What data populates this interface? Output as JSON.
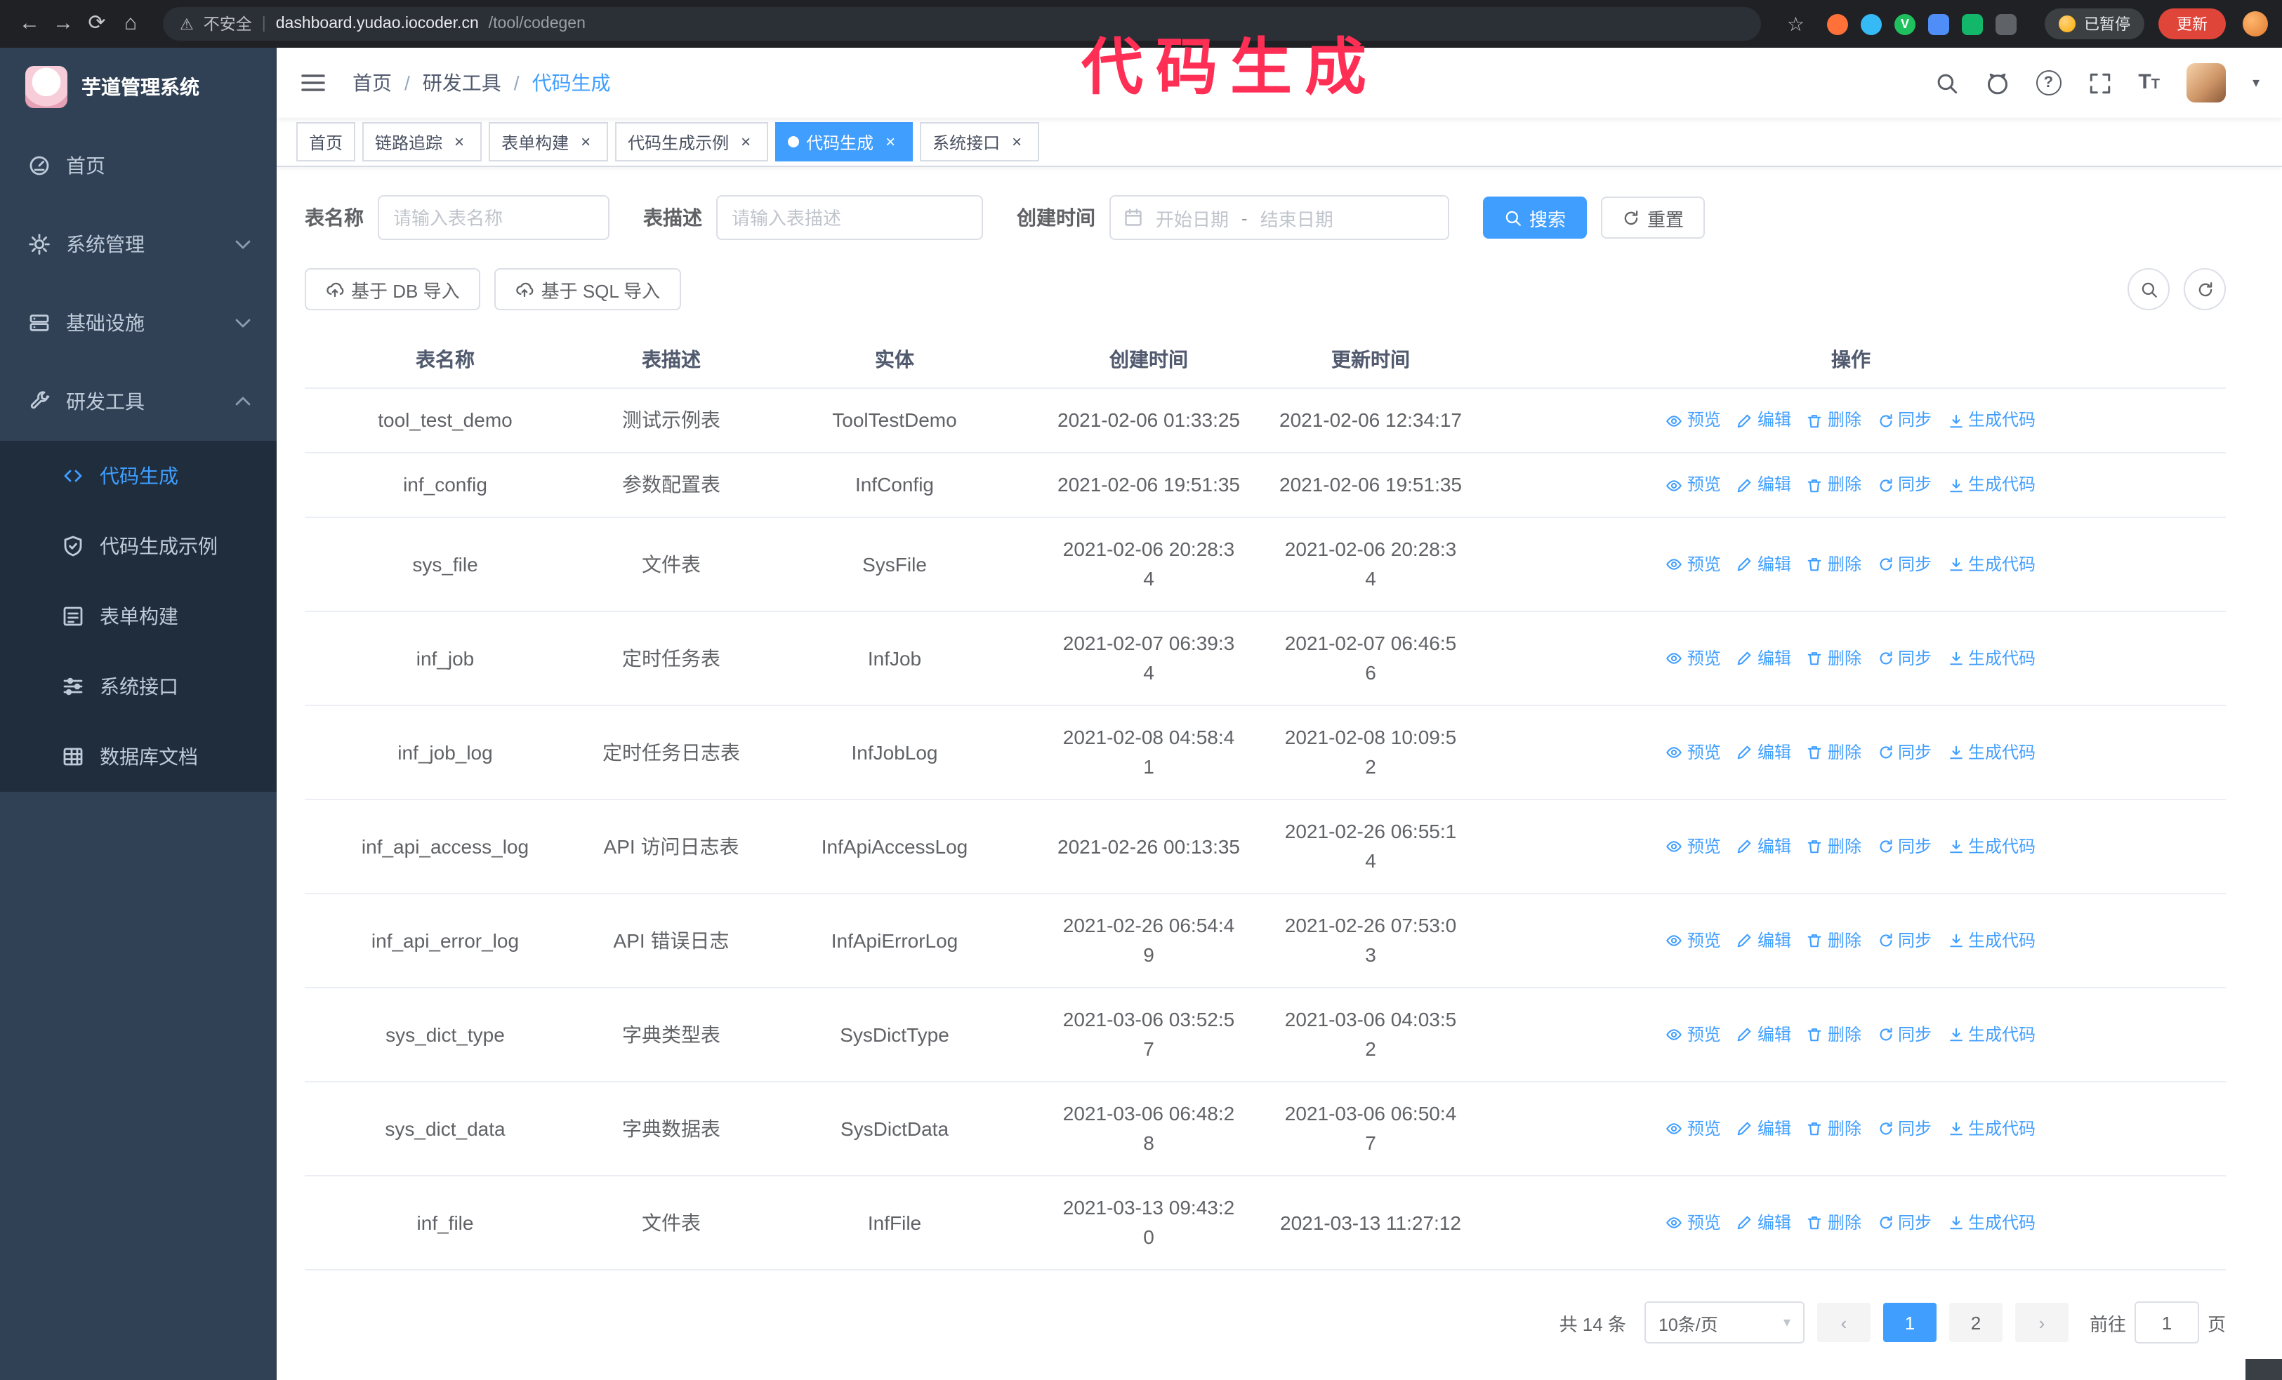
{
  "theme": {
    "accent": "#409eff",
    "sidebar_bg": "#304156",
    "submenu_bg": "#1f2d3d",
    "sidebar_text": "#bfcbd9",
    "chrome_bg": "#202124",
    "danger": "#e0453a",
    "annotation_color": "#ff2e55"
  },
  "annotation": {
    "text": "代码生成"
  },
  "glyphs": {
    "back": "←",
    "forward": "→",
    "reload": "⟳",
    "home": "⌂",
    "warning": "⚠",
    "star": "☆",
    "pipe": "|",
    "slash": "/",
    "close": "×",
    "caret_down": "▾",
    "prev": "‹",
    "next": "›",
    "letter_T": "T",
    "question": "?",
    "ext_v": "V"
  },
  "browser": {
    "security_label": "不安全",
    "url_host": "dashboard.yudao.iocoder.cn",
    "url_path": "/tool/codegen",
    "paused_badge": "已暂停",
    "update_button": "更新"
  },
  "sidebar": {
    "logo_title": "芋道管理系统",
    "items": [
      {
        "label": "首页",
        "icon": "dashboard-icon"
      },
      {
        "label": "系统管理",
        "icon": "gear-icon"
      },
      {
        "label": "基础设施",
        "icon": "server-icon"
      },
      {
        "label": "研发工具",
        "icon": "tools-icon"
      }
    ],
    "submenu": [
      {
        "label": "代码生成",
        "icon": "code-icon",
        "active": true
      },
      {
        "label": "代码生成示例",
        "icon": "shield-check-icon"
      },
      {
        "label": "表单构建",
        "icon": "form-icon"
      },
      {
        "label": "系统接口",
        "icon": "sliders-icon"
      },
      {
        "label": "数据库文档",
        "icon": "grid-icon"
      }
    ]
  },
  "navbar": {
    "breadcrumb": [
      "首页",
      "研发工具",
      "代码生成"
    ]
  },
  "tabs": [
    {
      "label": "首页",
      "closable": false,
      "active": false
    },
    {
      "label": "链路追踪",
      "closable": true,
      "active": false
    },
    {
      "label": "表单构建",
      "closable": true,
      "active": false
    },
    {
      "label": "代码生成示例",
      "closable": true,
      "active": false
    },
    {
      "label": "代码生成",
      "closable": true,
      "active": true
    },
    {
      "label": "系统接口",
      "closable": true,
      "active": false
    }
  ],
  "filters": {
    "table_name_label": "表名称",
    "table_name_placeholder": "请输入表名称",
    "table_desc_label": "表描述",
    "table_desc_placeholder": "请输入表描述",
    "create_time_label": "创建时间",
    "date_start_placeholder": "开始日期",
    "date_separator": "-",
    "date_end_placeholder": "结束日期",
    "search_button": "搜索",
    "reset_button": "重置"
  },
  "toolbar": {
    "import_db": "基于 DB 导入",
    "import_sql": "基于 SQL 导入"
  },
  "table": {
    "columns": [
      "表名称",
      "表描述",
      "实体",
      "创建时间",
      "更新时间",
      "操作"
    ],
    "actions": [
      "预览",
      "编辑",
      "删除",
      "同步",
      "生成代码"
    ],
    "rows": [
      {
        "name": "tool_test_demo",
        "desc": "测试示例表",
        "entity": "ToolTestDemo",
        "created": "2021-02-06 01:33:25",
        "updated": "2021-02-06 12:34:17"
      },
      {
        "name": "inf_config",
        "desc": "参数配置表",
        "entity": "InfConfig",
        "created": "2021-02-06 19:51:35",
        "updated": "2021-02-06 19:51:35"
      },
      {
        "name": "sys_file",
        "desc": "文件表",
        "entity": "SysFile",
        "created": "2021-02-06 20:28:3\n4",
        "updated": "2021-02-06 20:28:3\n4"
      },
      {
        "name": "inf_job",
        "desc": "定时任务表",
        "entity": "InfJob",
        "created": "2021-02-07 06:39:3\n4",
        "updated": "2021-02-07 06:46:5\n6"
      },
      {
        "name": "inf_job_log",
        "desc": "定时任务日志表",
        "entity": "InfJobLog",
        "created": "2021-02-08 04:58:4\n1",
        "updated": "2021-02-08 10:09:5\n2"
      },
      {
        "name": "inf_api_access_log",
        "desc": "API 访问日志表",
        "entity": "InfApiAccessLog",
        "created": "2021-02-26 00:13:35",
        "updated": "2021-02-26 06:55:1\n4"
      },
      {
        "name": "inf_api_error_log",
        "desc": "API 错误日志",
        "entity": "InfApiErrorLog",
        "created": "2021-02-26 06:54:4\n9",
        "updated": "2021-02-26 07:53:0\n3"
      },
      {
        "name": "sys_dict_type",
        "desc": "字典类型表",
        "entity": "SysDictType",
        "created": "2021-03-06 03:52:5\n7",
        "updated": "2021-03-06 04:03:5\n2"
      },
      {
        "name": "sys_dict_data",
        "desc": "字典数据表",
        "entity": "SysDictData",
        "created": "2021-03-06 06:48:2\n8",
        "updated": "2021-03-06 06:50:4\n7"
      },
      {
        "name": "inf_file",
        "desc": "文件表",
        "entity": "InfFile",
        "created": "2021-03-13 09:43:2\n0",
        "updated": "2021-03-13 11:27:12"
      }
    ]
  },
  "pagination": {
    "total": "共 14 条",
    "page_size": "10条/页",
    "pages": [
      {
        "label": "1",
        "active": true
      },
      {
        "label": "2",
        "active": false
      }
    ],
    "goto_label": "前往",
    "goto_value": "1",
    "page_label": "页"
  }
}
